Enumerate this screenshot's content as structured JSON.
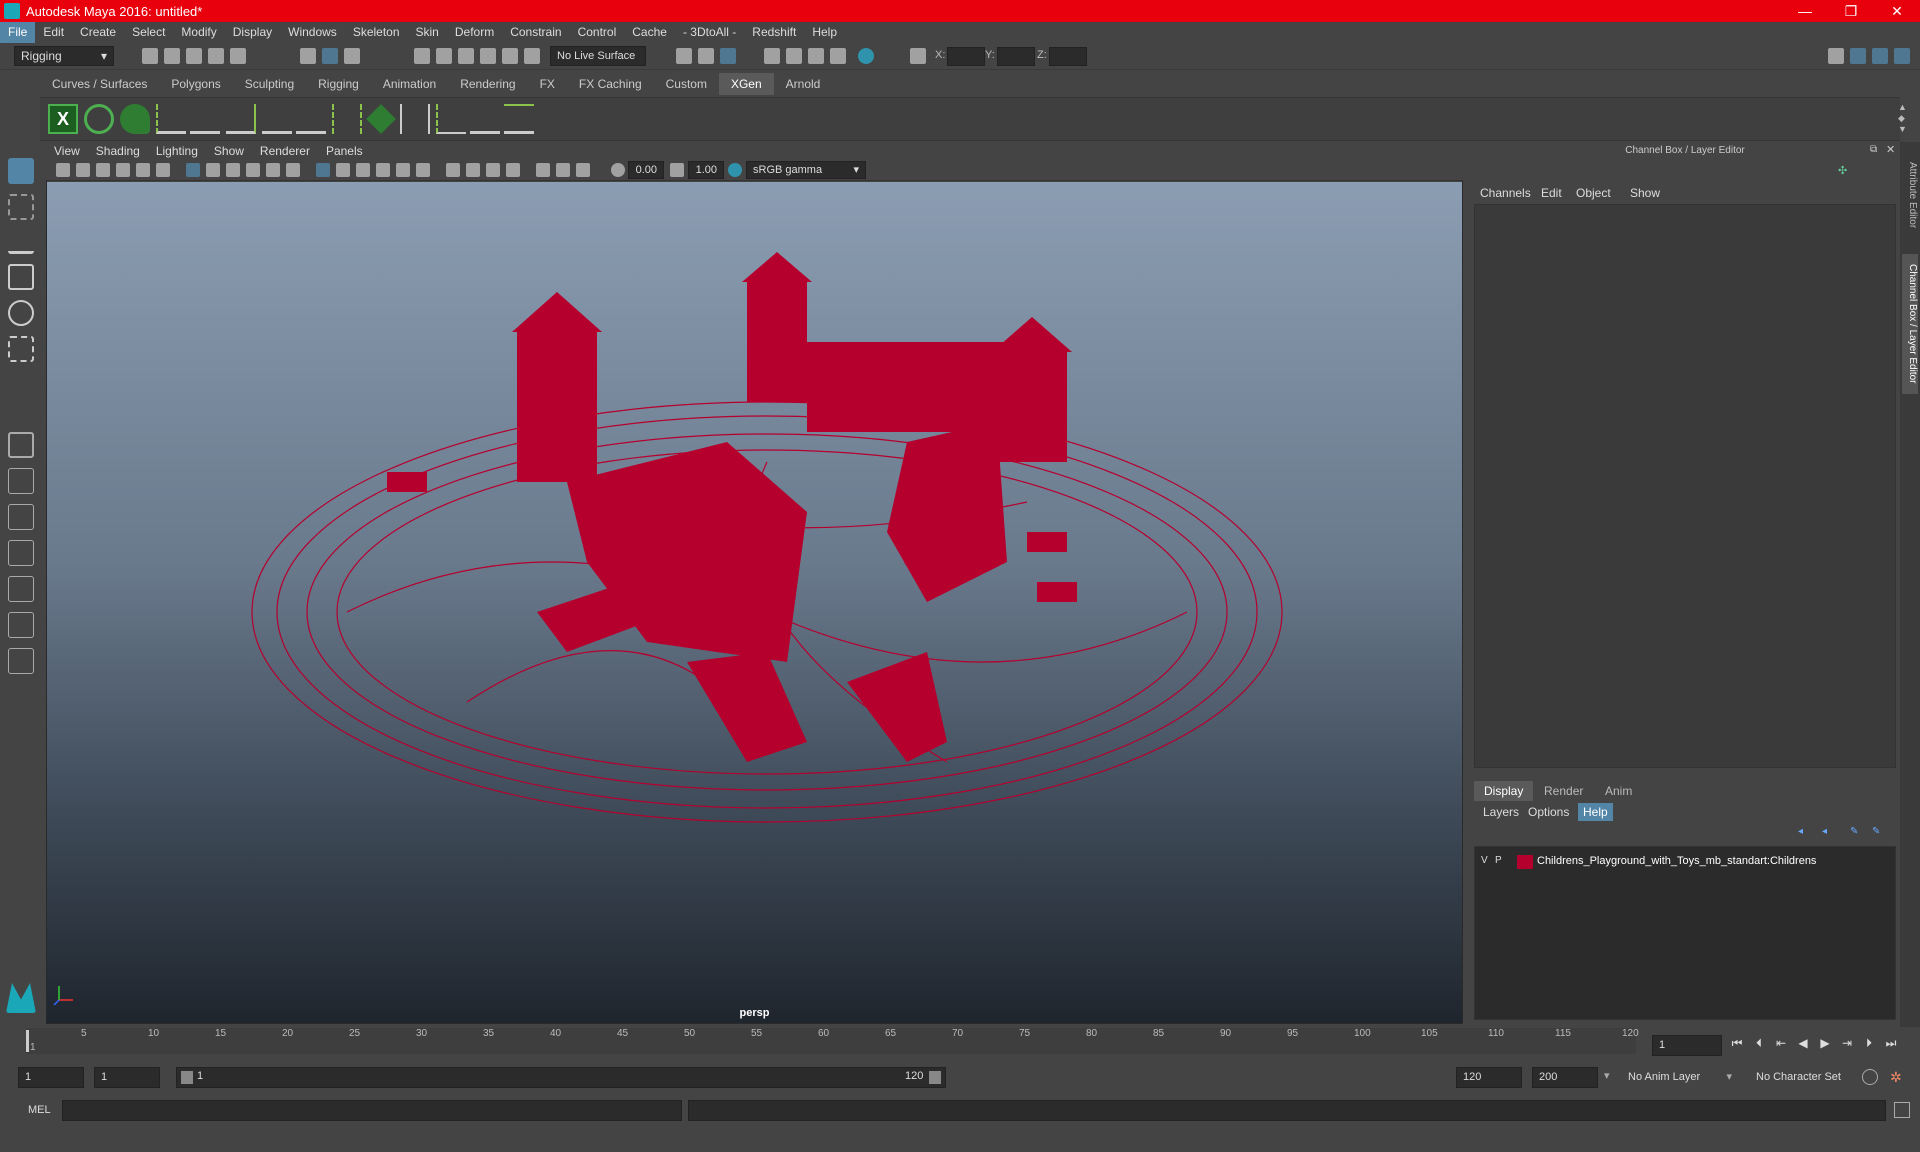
{
  "window": {
    "title": "Autodesk Maya 2016: untitled*",
    "controls": [
      "—",
      "❐",
      "✕"
    ]
  },
  "menus": [
    "File",
    "Edit",
    "Create",
    "Select",
    "Modify",
    "Display",
    "Windows",
    "Skeleton",
    "Skin",
    "Deform",
    "Constrain",
    "Control",
    "Cache",
    "- 3DtoAll -",
    "Redshift",
    "Help"
  ],
  "status": {
    "mode": "Rigging",
    "live_surface": "No Live Surface",
    "x_label": "X:",
    "y_label": "Y:",
    "z_label": "Z:"
  },
  "shelf_tabs": [
    "Curves / Surfaces",
    "Polygons",
    "Sculpting",
    "Rigging",
    "Animation",
    "Rendering",
    "FX",
    "FX Caching",
    "Custom",
    "XGen",
    "Arnold"
  ],
  "shelf_active": "XGen",
  "viewport": {
    "menus": [
      "View",
      "Shading",
      "Lighting",
      "Show",
      "Renderer",
      "Panels"
    ],
    "exposure": "0.00",
    "gamma": "1.00",
    "colorspace": "sRGB gamma",
    "camera": "persp",
    "wire_color": "#b5002e"
  },
  "right_panel": {
    "title": "Channel Box / Layer Editor",
    "menus": [
      "Channels",
      "Edit",
      "Object",
      "Show"
    ],
    "layer_tabs": [
      "Display",
      "Render",
      "Anim"
    ],
    "layer_sub": [
      "Layers",
      "Options",
      "Help"
    ],
    "layer": {
      "v": "V",
      "p": "P",
      "name": "Childrens_Playground_with_Toys_mb_standart:Childrens",
      "color": "#b5002e"
    }
  },
  "side_tabs": [
    "Attribute Editor",
    "Channel Box / Layer Editor"
  ],
  "timeline": {
    "ticks": [
      "1",
      "5",
      "10",
      "15",
      "20",
      "25",
      "30",
      "35",
      "40",
      "45",
      "50",
      "55",
      "60",
      "65",
      "70",
      "75",
      "80",
      "85",
      "90",
      "95",
      "100",
      "105",
      "110",
      "115",
      "120"
    ],
    "current": "1"
  },
  "range": {
    "start": "1",
    "start2": "1",
    "slider_start": "1",
    "slider_end": "120",
    "end": "120",
    "end2": "200",
    "anim_layer": "No Anim Layer",
    "char_set": "No Character Set"
  },
  "cmd": {
    "label": "MEL"
  }
}
